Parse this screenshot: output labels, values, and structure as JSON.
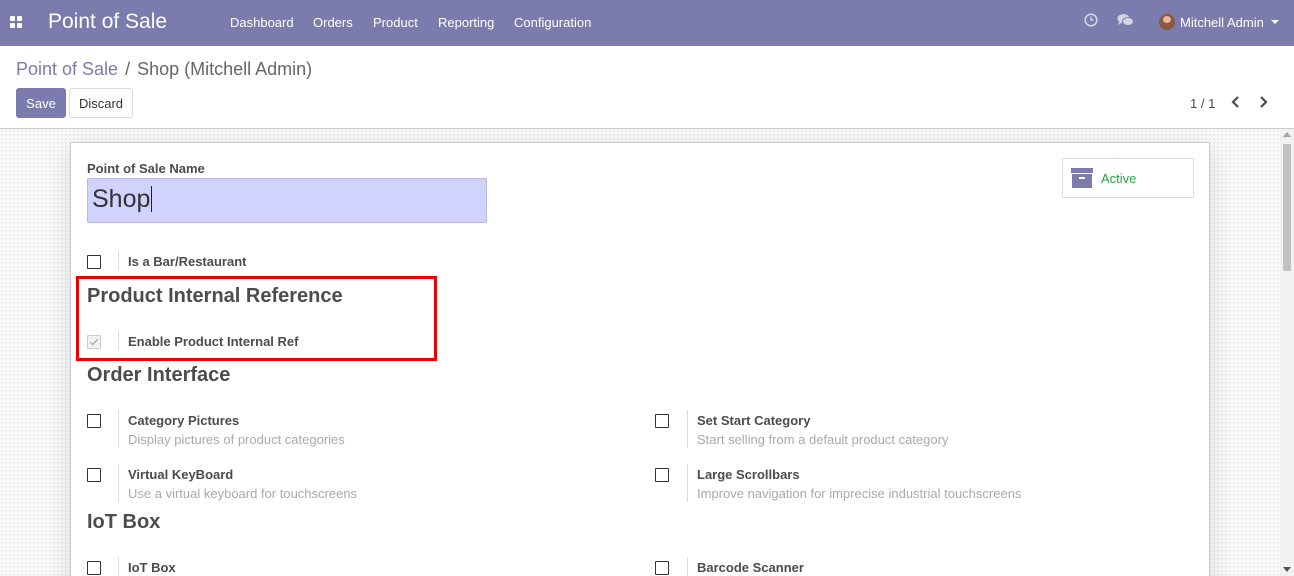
{
  "navbar": {
    "app_title": "Point of Sale",
    "menu": [
      "Dashboard",
      "Orders",
      "Product",
      "Reporting",
      "Configuration"
    ],
    "user_name": "Mitchell Admin"
  },
  "breadcrumb": {
    "parent": "Point of Sale",
    "separator": "/",
    "current": "Shop (Mitchell Admin)"
  },
  "toolbar": {
    "save_label": "Save",
    "discard_label": "Discard",
    "pager": "1 / 1"
  },
  "form": {
    "name_label": "Point of Sale Name",
    "name_value": "Shop",
    "active_label": "Active",
    "bar_restaurant_label": "Is a Bar/Restaurant",
    "section_product_ref": "Product Internal Reference",
    "enable_ref_label": "Enable Product Internal Ref",
    "section_order_interface": "Order Interface",
    "options": [
      {
        "label": "Category Pictures",
        "desc": "Display pictures of product categories"
      },
      {
        "label": "Set Start Category",
        "desc": "Start selling from a default product category"
      },
      {
        "label": "Virtual KeyBoard",
        "desc": "Use a virtual keyboard for touchscreens"
      },
      {
        "label": "Large Scrollbars",
        "desc": "Improve navigation for imprecise industrial touchscreens"
      }
    ],
    "section_iot": "IoT Box",
    "iot_options": [
      {
        "label": "IoT Box"
      },
      {
        "label": "Barcode Scanner"
      }
    ]
  },
  "colors": {
    "brand": "#7c7bad",
    "active_green": "#28a745",
    "highlight_red": "#e00000",
    "input_bg": "#d2d2ff"
  }
}
